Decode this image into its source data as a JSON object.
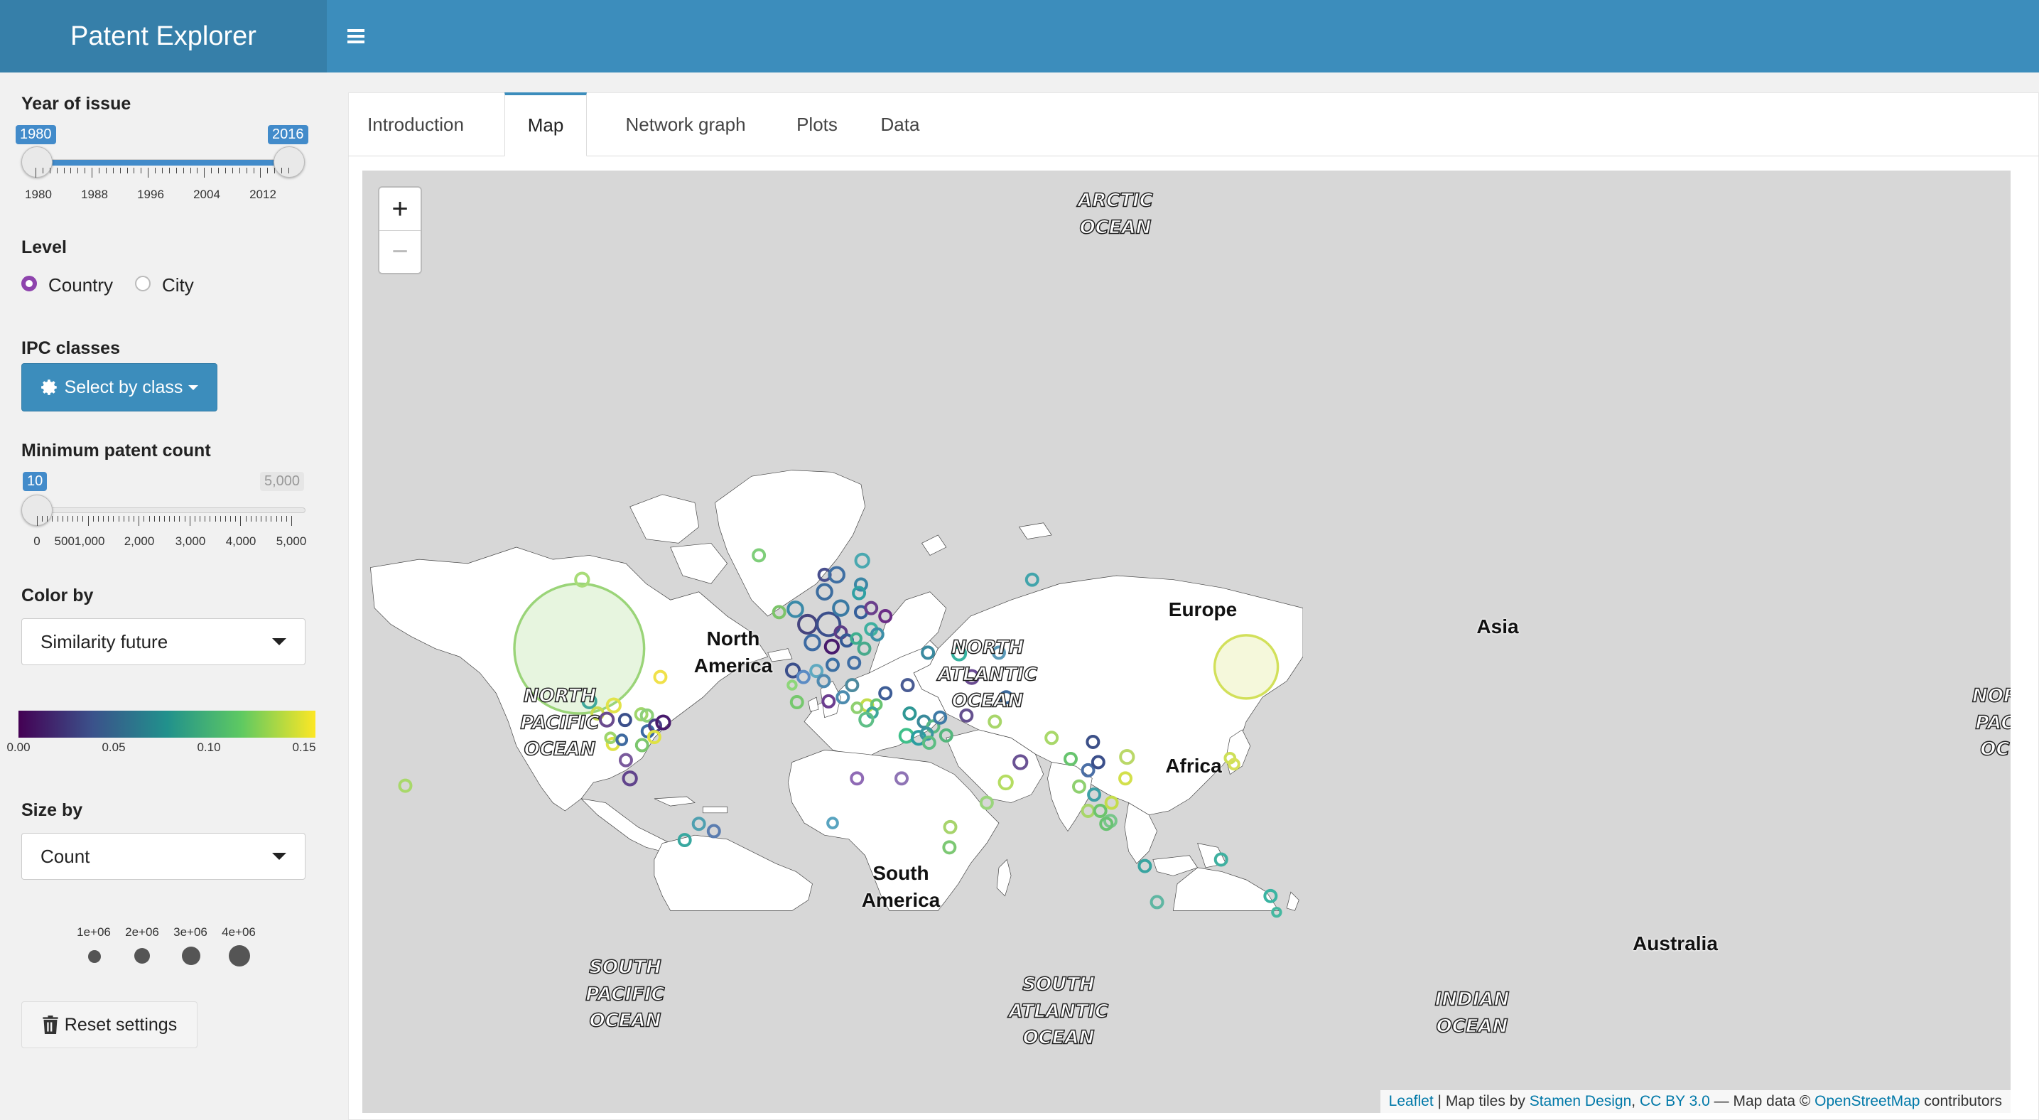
{
  "header": {
    "title": "Patent Explorer"
  },
  "sidebar": {
    "year": {
      "label": "Year of issue",
      "from": "1980",
      "to": "2016",
      "ticks": [
        "1980",
        "1988",
        "1996",
        "2004",
        "2012"
      ]
    },
    "level": {
      "label": "Level",
      "options": [
        "Country",
        "City"
      ],
      "selected": "Country"
    },
    "ipc": {
      "label": "IPC classes",
      "button": "Select by class"
    },
    "min_count": {
      "label": "Minimum patent count",
      "value": "10",
      "max": "5,000",
      "ticks": [
        "0",
        "5001,000",
        "2,000",
        "3,000",
        "4,000",
        "5,000"
      ]
    },
    "color_by": {
      "label": "Color by",
      "value": "Similarity future",
      "ticks": [
        "0.00",
        "0.05",
        "0.10",
        "0.15"
      ]
    },
    "size_by": {
      "label": "Size by",
      "value": "Count",
      "legend": [
        "1e+06",
        "2e+06",
        "3e+06",
        "4e+06"
      ]
    },
    "reset": "Reset settings"
  },
  "tabs": [
    {
      "label": "Introduction",
      "active": false
    },
    {
      "label": "Map",
      "active": true
    },
    {
      "label": "Network graph",
      "active": false
    },
    {
      "label": "Plots",
      "active": false
    },
    {
      "label": "Data",
      "active": false
    }
  ],
  "map": {
    "zoom_in": "+",
    "zoom_out": "−",
    "oceans": {
      "arctic": [
        "ARCTIC",
        "OCEAN"
      ],
      "north_pacific": [
        "NORTH",
        "PACIFIC",
        "OCEAN"
      ],
      "north_atlantic": [
        "NORTH",
        "ATLANTIC",
        "OCEAN"
      ],
      "south_pacific": [
        "SOUTH",
        "PACIFIC",
        "OCEAN"
      ],
      "south_atlantic": [
        "SOUTH",
        "ATLANTIC",
        "OCEAN"
      ],
      "indian": [
        "INDIAN",
        "OCEAN"
      ],
      "north_pacific_right": [
        "NOR",
        "PAC",
        "OC"
      ]
    },
    "continents": {
      "north_america": "North\nAmerica",
      "south_america": "South\nAmerica",
      "europe": "Europe",
      "africa": "Africa",
      "asia": "Asia",
      "australia": "Australia"
    },
    "attribution": {
      "leaflet": "Leaflet",
      "tiles_prefix": " | Map tiles by ",
      "stamen": "Stamen Design",
      "sep": ", ",
      "cc": "CC BY 3.0",
      "data_prefix": " — Map data © ",
      "osm": "OpenStreetMap",
      "suffix": " contributors"
    }
  },
  "colors": {
    "header": "#3c8dbc",
    "brand": "#367fa9",
    "accent": "#428bca",
    "radio": "#8e44ad"
  }
}
